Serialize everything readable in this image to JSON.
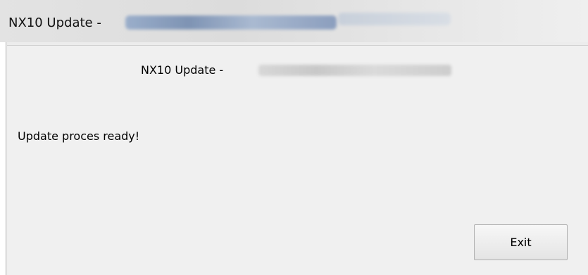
{
  "window": {
    "title": "NX10 Update -"
  },
  "dialog": {
    "header": "NX10 Update -",
    "status": "Update proces ready!",
    "exit_label": "Exit"
  }
}
